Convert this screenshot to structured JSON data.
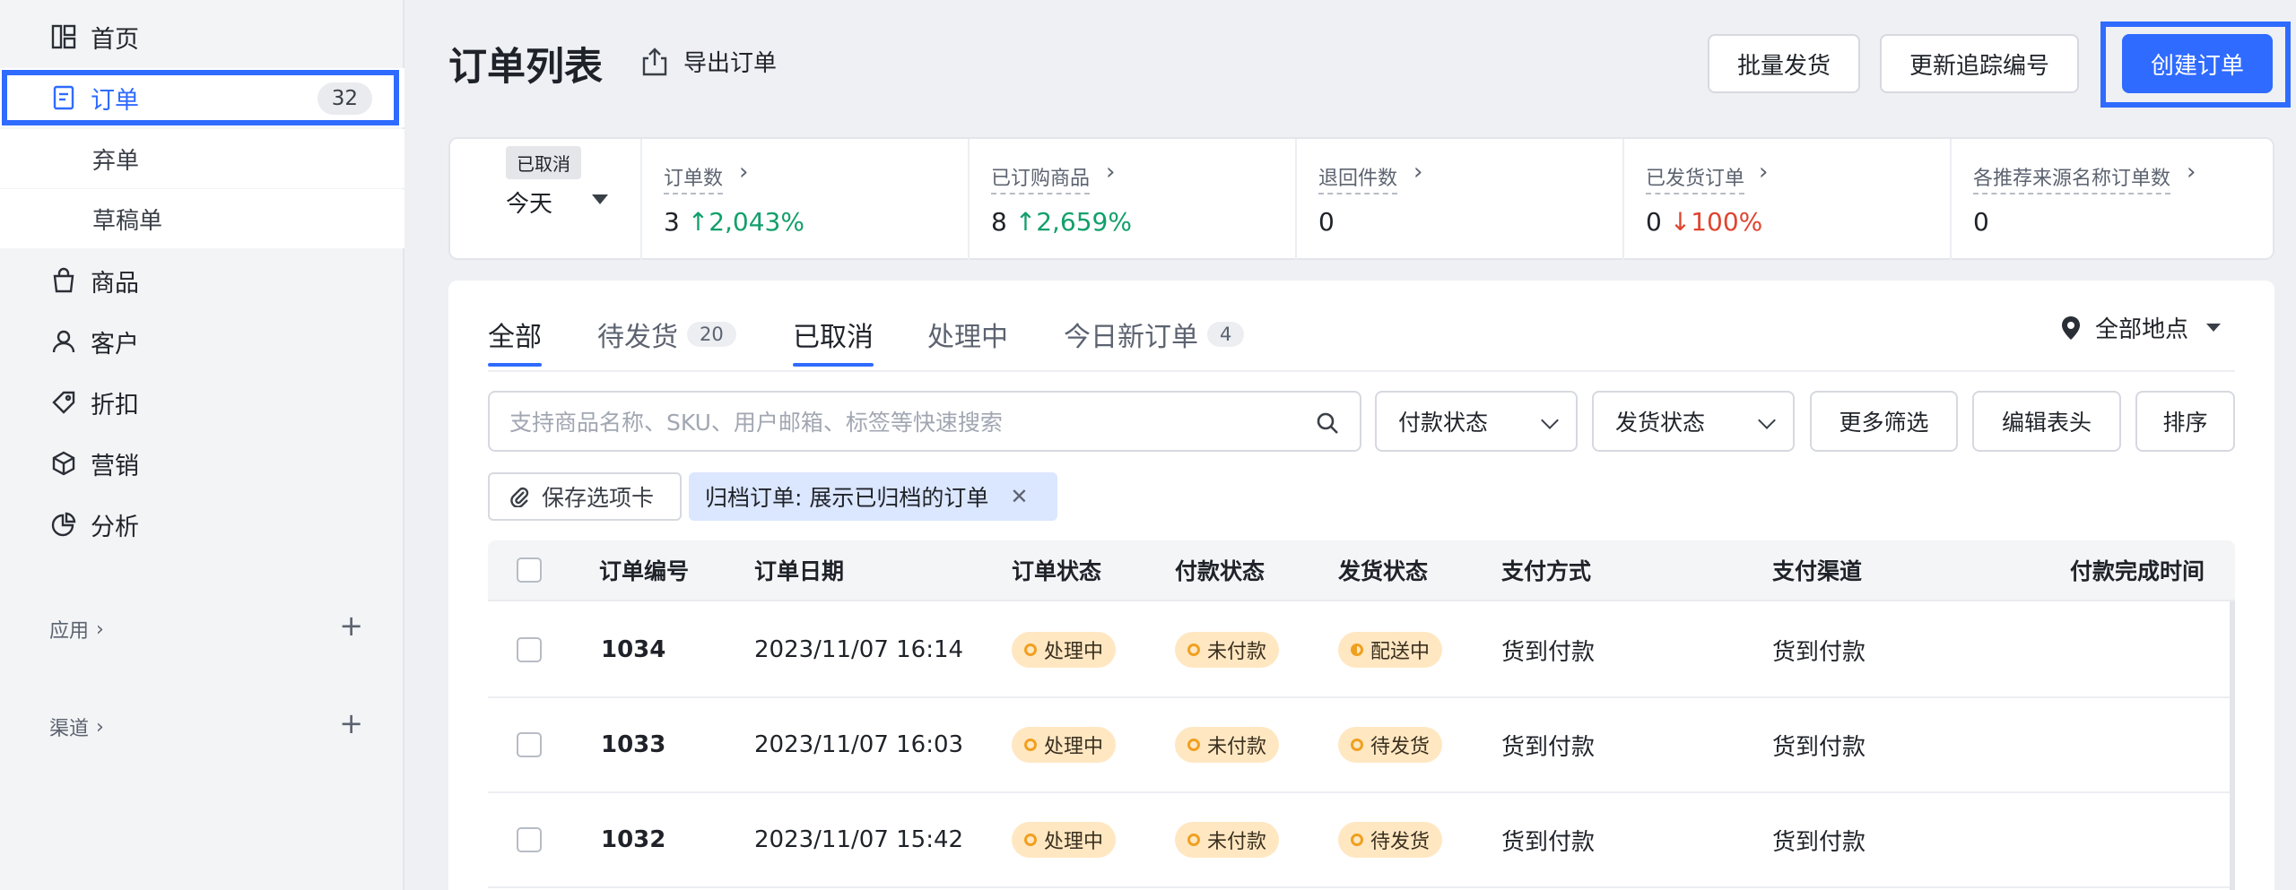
{
  "sidebar": {
    "items": [
      {
        "label": "首页",
        "icon": "dashboard-icon"
      },
      {
        "label": "订单",
        "icon": "order-icon",
        "badge": "32",
        "active": true
      },
      {
        "label": "弃单"
      },
      {
        "label": "草稿单"
      },
      {
        "label": "商品",
        "icon": "bag-icon"
      },
      {
        "label": "客户",
        "icon": "user-icon"
      },
      {
        "label": "折扣",
        "icon": "tag-icon"
      },
      {
        "label": "营销",
        "icon": "cube-icon"
      },
      {
        "label": "分析",
        "icon": "pie-chart-icon"
      }
    ],
    "apps_label": "应用",
    "channels_label": "渠道"
  },
  "header": {
    "title": "订单列表",
    "export_label": "导出订单",
    "bulk_ship_label": "批量发货",
    "update_tracking_label": "更新追踪编号",
    "create_order_label": "创建订单"
  },
  "stats": {
    "date_tooltip": "已取消",
    "date_value": "今天",
    "items": [
      {
        "label": "订单数",
        "value": "3",
        "delta": "2,043%",
        "trend": "up"
      },
      {
        "label": "已订购商品",
        "value": "8",
        "delta": "2,659%",
        "trend": "up"
      },
      {
        "label": "退回件数",
        "value": "0",
        "delta": "",
        "trend": ""
      },
      {
        "label": "已发货订单",
        "value": "0",
        "delta": "100%",
        "trend": "down"
      },
      {
        "label": "各推荐来源名称订单数",
        "value": "0",
        "delta": "",
        "trend": ""
      }
    ]
  },
  "tabs": [
    {
      "label": "全部",
      "count": "",
      "active": true
    },
    {
      "label": "待发货",
      "count": "20"
    },
    {
      "label": "已取消",
      "count": "",
      "active": true
    },
    {
      "label": "处理中",
      "count": ""
    },
    {
      "label": "今日新订单",
      "count": "4"
    }
  ],
  "location": {
    "label": "全部地点"
  },
  "filters": {
    "search_placeholder": "支持商品名称、SKU、用户邮箱、标签等快速搜索",
    "payment_status": "付款状态",
    "shipping_status": "发货状态",
    "more_filters": "更多筛选",
    "edit_columns": "编辑表头",
    "sort": "排序",
    "save_tab": "保存选项卡",
    "active_filter": "归档订单: 展示已归档的订单"
  },
  "table": {
    "columns": [
      "订单编号",
      "订单日期",
      "订单状态",
      "付款状态",
      "发货状态",
      "支付方式",
      "支付渠道",
      "付款完成时间"
    ],
    "rows": [
      {
        "id": "1034",
        "date": "2023/11/07 16:14",
        "order_status": "处理中",
        "payment_status": "未付款",
        "shipping_status": "配送中",
        "payment_method": "货到付款",
        "payment_channel": "货到付款",
        "paid_time": ""
      },
      {
        "id": "1033",
        "date": "2023/11/07 16:03",
        "order_status": "处理中",
        "payment_status": "未付款",
        "shipping_status": "待发货",
        "payment_method": "货到付款",
        "payment_channel": "货到付款",
        "paid_time": ""
      },
      {
        "id": "1032",
        "date": "2023/11/07 15:42",
        "order_status": "处理中",
        "payment_status": "未付款",
        "shipping_status": "待发货",
        "payment_method": "货到付款",
        "payment_channel": "货到付款",
        "paid_time": ""
      }
    ]
  },
  "colors": {
    "accent": "#2f6bff",
    "up": "#12a06b",
    "down": "#e0442f",
    "pill_bg": "#ffe7c2",
    "pill_dot": "#f0a020"
  }
}
